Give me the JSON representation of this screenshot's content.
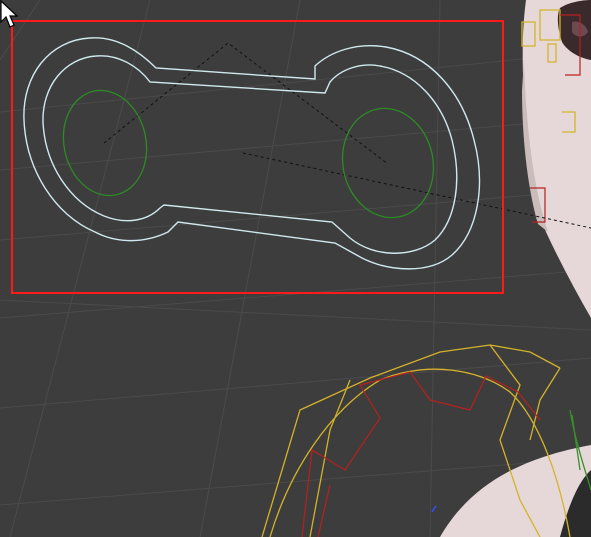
{
  "viewport": {
    "background": "#3d3d3d",
    "grid_color": "#4a4a4a"
  },
  "selection": {
    "color": "#ff1a1a"
  },
  "controls": {
    "rig_outline_color": "#cfe9ee",
    "eye_target_color": "#2e8a26",
    "relationship_line_color": "#111111"
  },
  "armature": {
    "bone_color": "#d4b32a",
    "deform_color": "#b82020",
    "accent_green": "#3a8f2c"
  },
  "character": {
    "skin_color": "#e6d8d8",
    "shadow_color": "#b8a8a8"
  },
  "icons": {
    "cursor": "arrow-cursor-icon"
  }
}
